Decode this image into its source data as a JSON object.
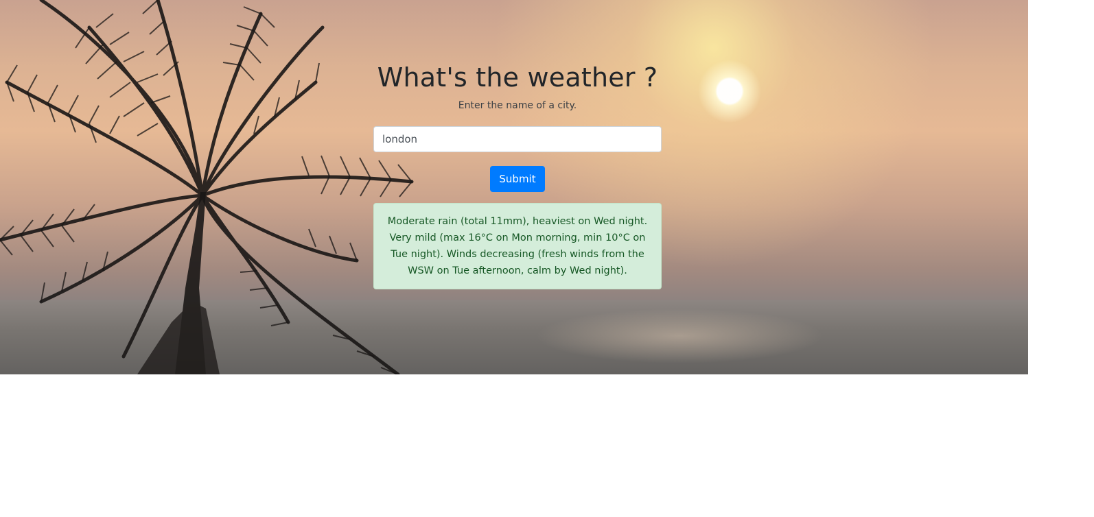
{
  "header": {
    "title": "What's the weather ?",
    "subtitle": "Enter the name of a city."
  },
  "form": {
    "city_value": "london",
    "submit_label": "Submit"
  },
  "result": {
    "text": "Moderate rain (total 11mm), heaviest on Wed night. Very mild (max 16°C on Mon morning, min 10°C on Tue night). Winds decreasing (fresh winds from the WSW on Tue afternoon, calm by Wed night)."
  },
  "colors": {
    "primary_button": "#007bff",
    "alert_success_bg": "#d4edda",
    "alert_success_text": "#155724"
  },
  "background": {
    "icon": "palm-tree-sunset-image"
  }
}
